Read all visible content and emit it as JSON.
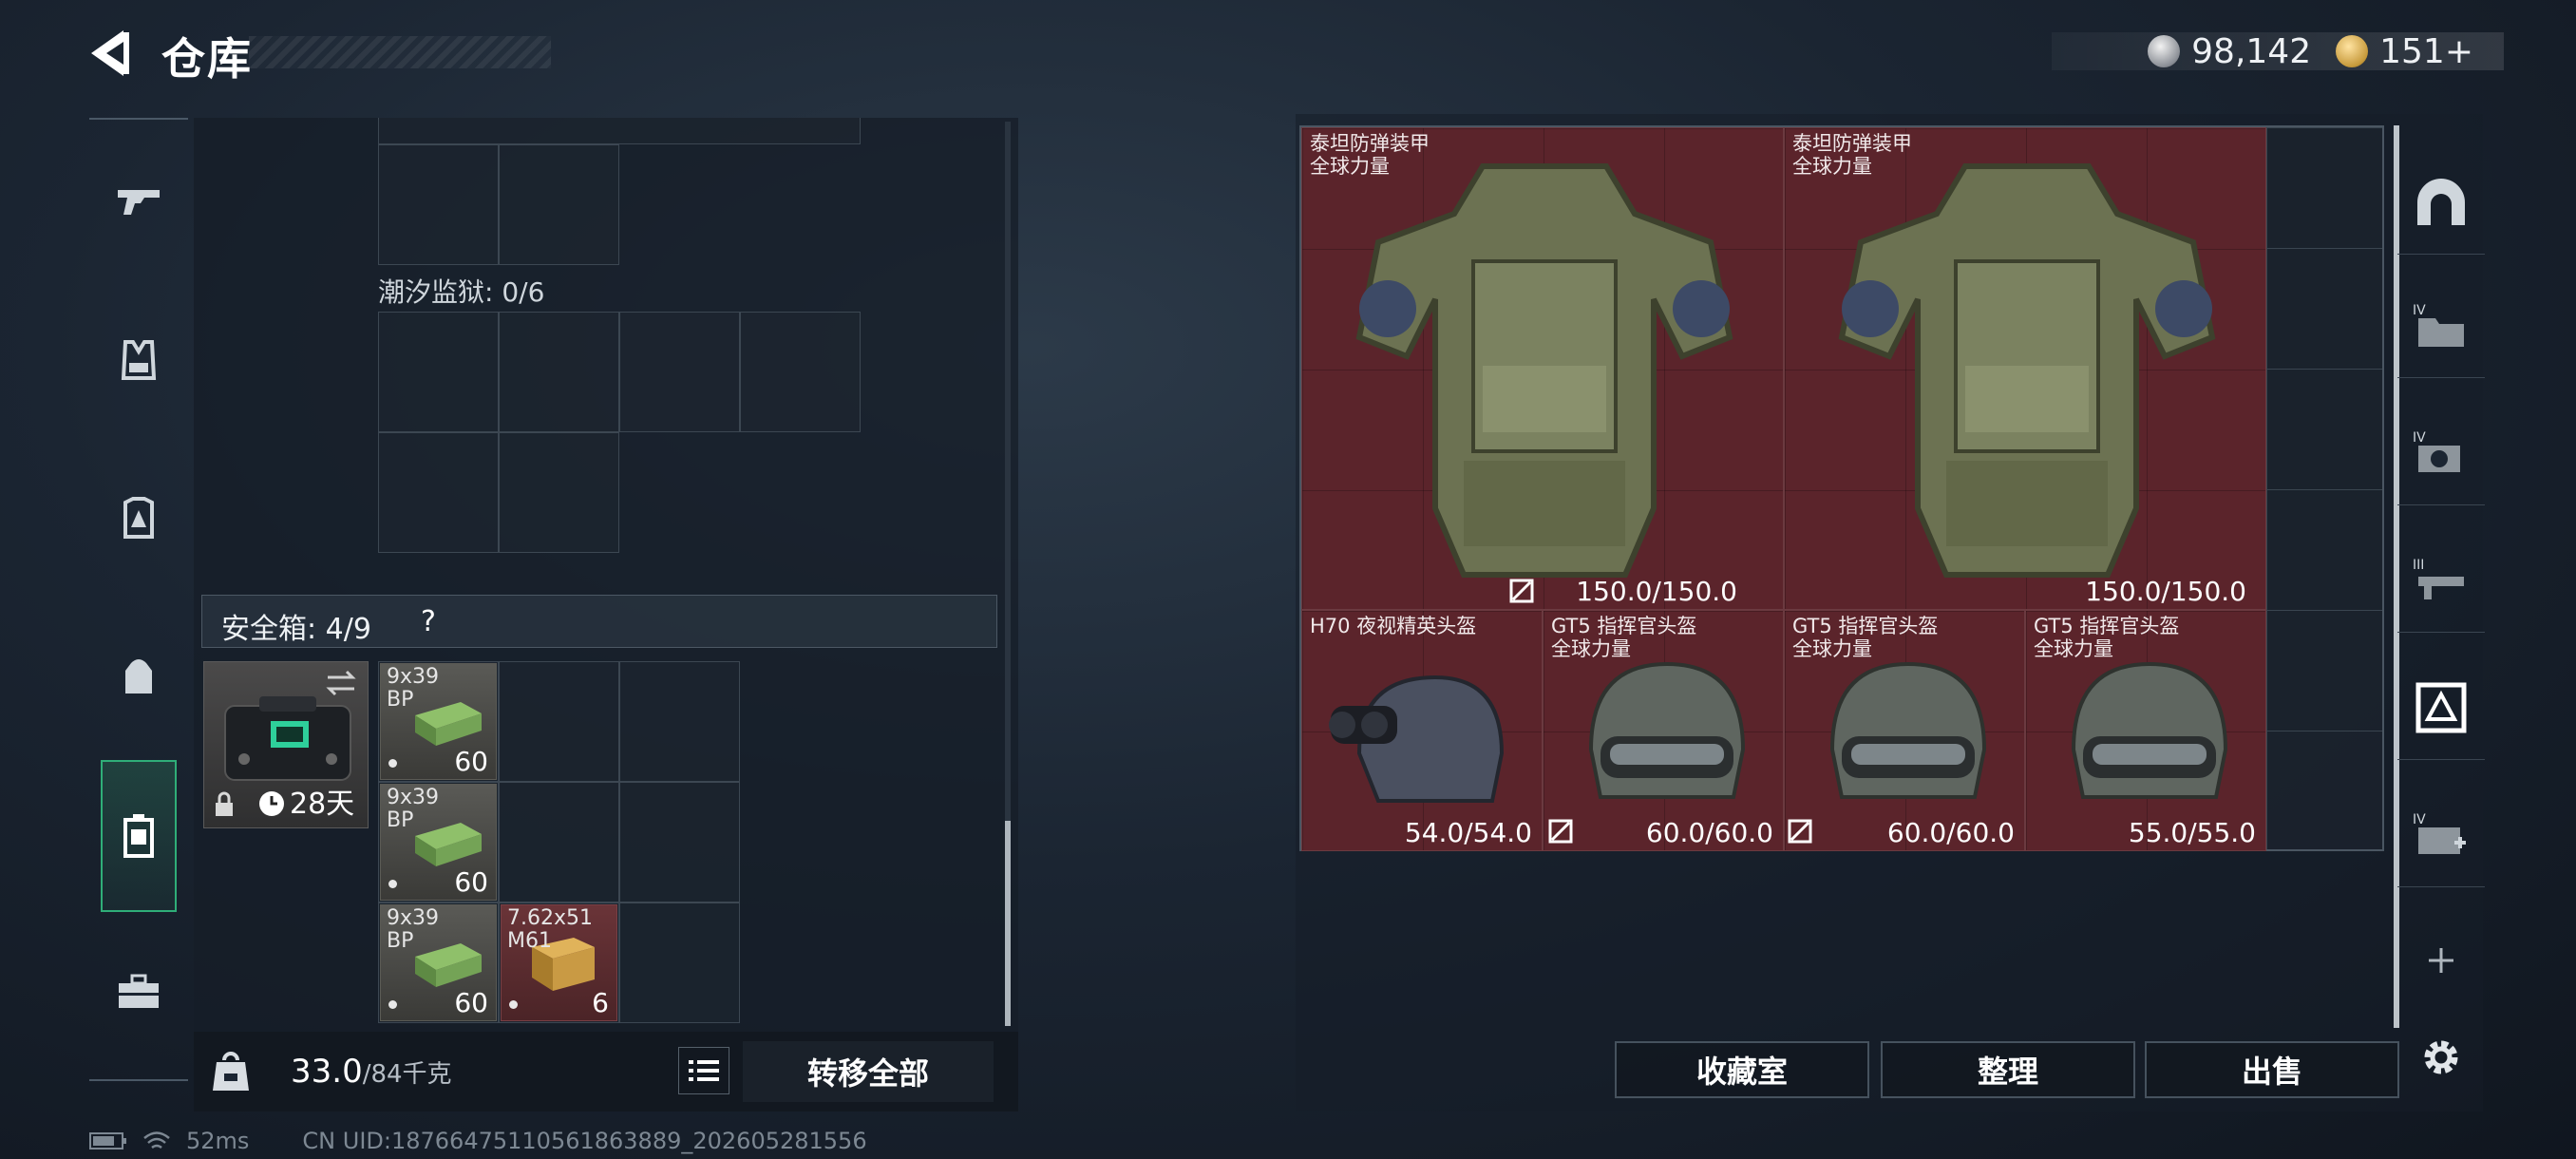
{
  "header": {
    "title": "仓库",
    "currencies": [
      {
        "icon": "silver-coin-icon",
        "value": "98,142"
      },
      {
        "icon": "gold-coin-icon",
        "value": "151+"
      }
    ]
  },
  "left_panel": {
    "prison_label": "潮汐监狱: 0/6",
    "safe_box": {
      "title": "安全箱: 4/9",
      "help": "?",
      "timer": "28天"
    },
    "ammo": [
      {
        "name": "9x39\nBP",
        "qty": "60"
      },
      {
        "name": "9x39\nBP",
        "qty": "60"
      },
      {
        "name": "9x39\nBP",
        "qty": "60"
      },
      {
        "name": "7.62x51\nM61",
        "qty": "6"
      }
    ],
    "weight_value": "33.0",
    "weight_max": "/84千克",
    "transfer_label": "转移全部"
  },
  "stash": {
    "items": [
      {
        "name": "泰坦防弹装甲\n全球力量",
        "durability": "150.0/150.0",
        "no_insure": true
      },
      {
        "name": "泰坦防弹装甲\n全球力量",
        "durability": "150.0/150.0",
        "no_insure": false
      },
      {
        "name": "H70 夜视精英头盔",
        "durability": "54.0/54.0",
        "no_insure": true
      },
      {
        "name": "GT5 指挥官头盔\n全球力量",
        "durability": "60.0/60.0",
        "no_insure": true
      },
      {
        "name": "GT5 指挥官头盔\n全球力量",
        "durability": "60.0/60.0",
        "no_insure": false
      },
      {
        "name": "GT5 指挥官头盔\n全球力量",
        "durability": "55.0/55.0",
        "no_insure": false
      }
    ]
  },
  "actions": {
    "collection": "收藏室",
    "sort": "整理",
    "sell": "出售"
  },
  "status_bar": {
    "ping": "52ms",
    "uid": "CN UID:1876647511056186388​9_202605281556"
  },
  "colors": {
    "accent_green": "#2fae78",
    "item_red": "#5b242b"
  }
}
